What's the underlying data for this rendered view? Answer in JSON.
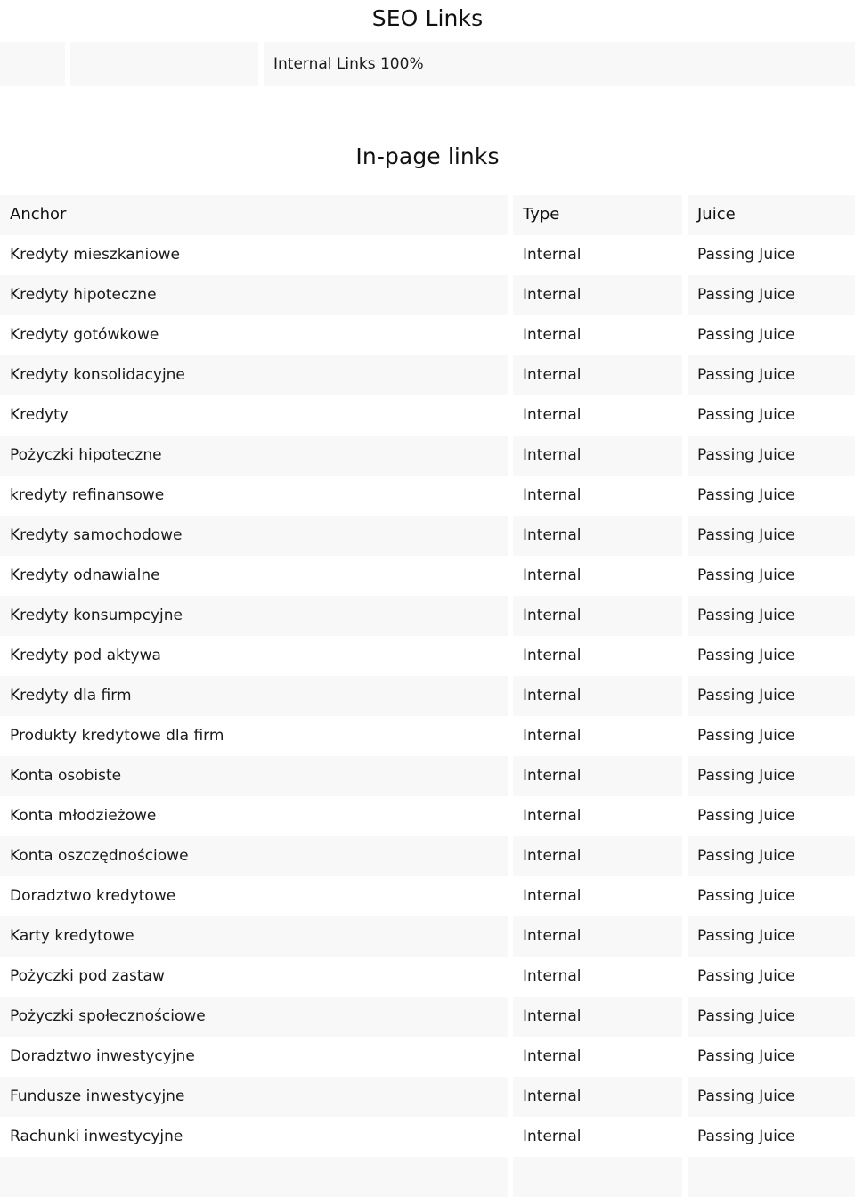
{
  "section": {
    "title": "SEO Links"
  },
  "summary": {
    "cell1": "",
    "cell2": "",
    "internal_links_label": "Internal Links 100%"
  },
  "inpage": {
    "title": "In-page links",
    "columns": {
      "anchor": "Anchor",
      "type": "Type",
      "juice": "Juice"
    },
    "rows": [
      {
        "anchor": "Kredyty mieszkaniowe",
        "type": "Internal",
        "juice": "Passing Juice"
      },
      {
        "anchor": "Kredyty hipoteczne",
        "type": "Internal",
        "juice": "Passing Juice"
      },
      {
        "anchor": "Kredyty gotówkowe",
        "type": "Internal",
        "juice": "Passing Juice"
      },
      {
        "anchor": "Kredyty konsolidacyjne",
        "type": "Internal",
        "juice": "Passing Juice"
      },
      {
        "anchor": "Kredyty",
        "type": "Internal",
        "juice": "Passing Juice"
      },
      {
        "anchor": "Pożyczki hipoteczne",
        "type": "Internal",
        "juice": "Passing Juice"
      },
      {
        "anchor": "kredyty refinansowe",
        "type": "Internal",
        "juice": "Passing Juice"
      },
      {
        "anchor": "Kredyty samochodowe",
        "type": "Internal",
        "juice": "Passing Juice"
      },
      {
        "anchor": "Kredyty odnawialne",
        "type": "Internal",
        "juice": "Passing Juice"
      },
      {
        "anchor": "Kredyty konsumpcyjne",
        "type": "Internal",
        "juice": "Passing Juice"
      },
      {
        "anchor": "Kredyty pod aktywa",
        "type": "Internal",
        "juice": "Passing Juice"
      },
      {
        "anchor": "Kredyty dla firm",
        "type": "Internal",
        "juice": "Passing Juice"
      },
      {
        "anchor": "Produkty kredytowe dla firm",
        "type": "Internal",
        "juice": "Passing Juice"
      },
      {
        "anchor": "Konta osobiste",
        "type": "Internal",
        "juice": "Passing Juice"
      },
      {
        "anchor": "Konta młodzieżowe",
        "type": "Internal",
        "juice": "Passing Juice"
      },
      {
        "anchor": "Konta oszczędnościowe",
        "type": "Internal",
        "juice": "Passing Juice"
      },
      {
        "anchor": "Doradztwo kredytowe",
        "type": "Internal",
        "juice": "Passing Juice"
      },
      {
        "anchor": "Karty kredytowe",
        "type": "Internal",
        "juice": "Passing Juice"
      },
      {
        "anchor": "Pożyczki pod zastaw",
        "type": "Internal",
        "juice": "Passing Juice"
      },
      {
        "anchor": "Pożyczki społecznościowe",
        "type": "Internal",
        "juice": "Passing Juice"
      },
      {
        "anchor": "Doradztwo inwestycyjne",
        "type": "Internal",
        "juice": "Passing Juice"
      },
      {
        "anchor": "Fundusze inwestycyjne",
        "type": "Internal",
        "juice": "Passing Juice"
      },
      {
        "anchor": "Rachunki inwestycyjne",
        "type": "Internal",
        "juice": "Passing Juice"
      },
      {
        "anchor": "",
        "type": "",
        "juice": ""
      }
    ]
  },
  "colors": {
    "stripe": "#f8f8f9",
    "background": "#ffffff",
    "text": "#1a1a1a"
  }
}
